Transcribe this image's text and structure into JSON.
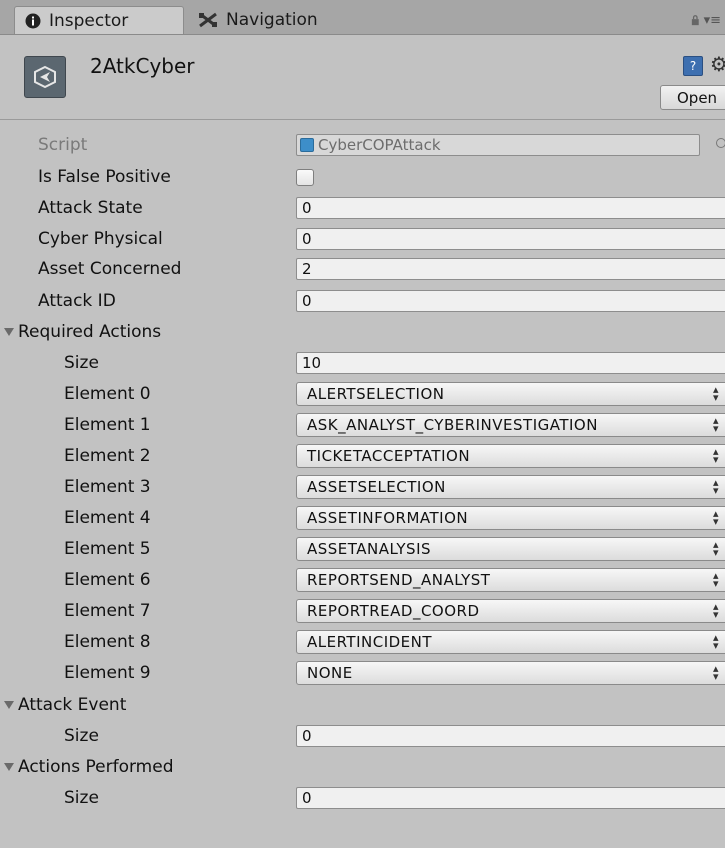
{
  "tabs": [
    {
      "label": "Inspector",
      "icon": "info-icon",
      "active": true
    },
    {
      "label": "Navigation",
      "icon": "navigation-icon",
      "active": false
    }
  ],
  "header": {
    "object_name": "2AtkCyber",
    "open_label": "Open"
  },
  "script": {
    "label": "Script",
    "value": "CyberCOPAttack"
  },
  "fields": {
    "is_false_positive": {
      "label": "Is False Positive",
      "checked": false
    },
    "attack_state": {
      "label": "Attack State",
      "value": "0"
    },
    "cyber_physical": {
      "label": "Cyber Physical",
      "value": "0"
    },
    "asset_concerned": {
      "label": "Asset Concerned",
      "value": "2"
    },
    "attack_id": {
      "label": "Attack ID",
      "value": "0"
    }
  },
  "required_actions": {
    "label": "Required Actions",
    "size_label": "Size",
    "size": "10",
    "elements": [
      {
        "label": "Element 0",
        "value": "ALERTSELECTION"
      },
      {
        "label": "Element 1",
        "value": "ASK_ANALYST_CYBERINVESTIGATION"
      },
      {
        "label": "Element 2",
        "value": "TICKETACCEPTATION"
      },
      {
        "label": "Element 3",
        "value": "ASSETSELECTION"
      },
      {
        "label": "Element 4",
        "value": "ASSETINFORMATION"
      },
      {
        "label": "Element 5",
        "value": "ASSETANALYSIS"
      },
      {
        "label": "Element 6",
        "value": "REPORTSEND_ANALYST"
      },
      {
        "label": "Element 7",
        "value": "REPORTREAD_COORD"
      },
      {
        "label": "Element 8",
        "value": "ALERTINCIDENT"
      },
      {
        "label": "Element 9",
        "value": "NONE"
      }
    ]
  },
  "attack_event": {
    "label": "Attack Event",
    "size_label": "Size",
    "size": "0"
  },
  "actions_performed": {
    "label": "Actions Performed",
    "size_label": "Size",
    "size": "0"
  }
}
